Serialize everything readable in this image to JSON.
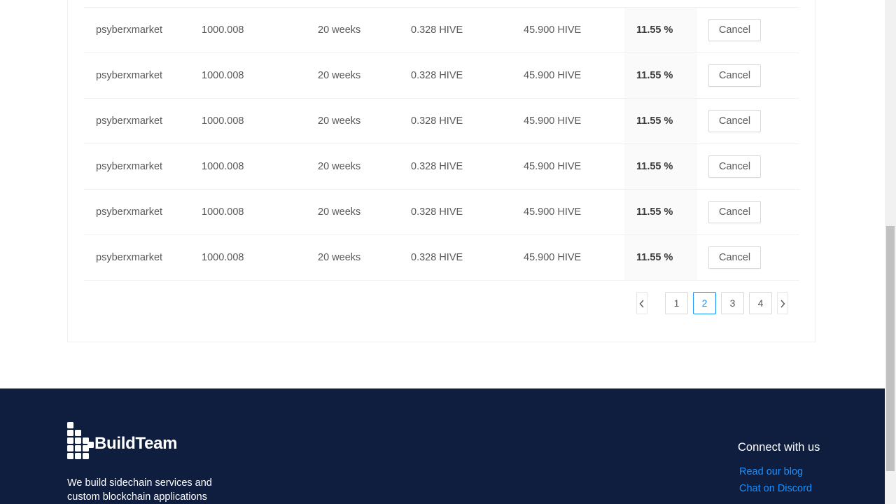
{
  "table": {
    "rows": [
      {
        "account": "psyberxmarket",
        "amount": "1000.008",
        "duration": "20 weeks",
        "fee": "0.328 HIVE",
        "total": "45.900 HIVE",
        "apr": "11.55 %",
        "action": "Cancel"
      },
      {
        "account": "psyberxmarket",
        "amount": "1000.008",
        "duration": "20 weeks",
        "fee": "0.328 HIVE",
        "total": "45.900 HIVE",
        "apr": "11.55 %",
        "action": "Cancel"
      },
      {
        "account": "psyberxmarket",
        "amount": "1000.008",
        "duration": "20 weeks",
        "fee": "0.328 HIVE",
        "total": "45.900 HIVE",
        "apr": "11.55 %",
        "action": "Cancel"
      },
      {
        "account": "psyberxmarket",
        "amount": "1000.008",
        "duration": "20 weeks",
        "fee": "0.328 HIVE",
        "total": "45.900 HIVE",
        "apr": "11.55 %",
        "action": "Cancel"
      },
      {
        "account": "psyberxmarket",
        "amount": "1000.008",
        "duration": "20 weeks",
        "fee": "0.328 HIVE",
        "total": "45.900 HIVE",
        "apr": "11.55 %",
        "action": "Cancel"
      },
      {
        "account": "psyberxmarket",
        "amount": "1000.008",
        "duration": "20 weeks",
        "fee": "0.328 HIVE",
        "total": "45.900 HIVE",
        "apr": "11.55 %",
        "action": "Cancel"
      }
    ]
  },
  "pagination": {
    "prev_icon": "chevron-left-icon",
    "pages": [
      "1",
      "2",
      "3",
      "4"
    ],
    "current": "2",
    "next_icon": "chevron-right-icon"
  },
  "footer": {
    "brand": "BuildTeam",
    "tagline": "We build sidechain services and custom blockchain applications",
    "connect_title": "Connect with us",
    "links": [
      "Read our blog",
      "Chat on Discord"
    ]
  },
  "colors": {
    "footer_bg": "#0f1e3e",
    "link": "#1890ff",
    "active_page": "#1890ff"
  }
}
